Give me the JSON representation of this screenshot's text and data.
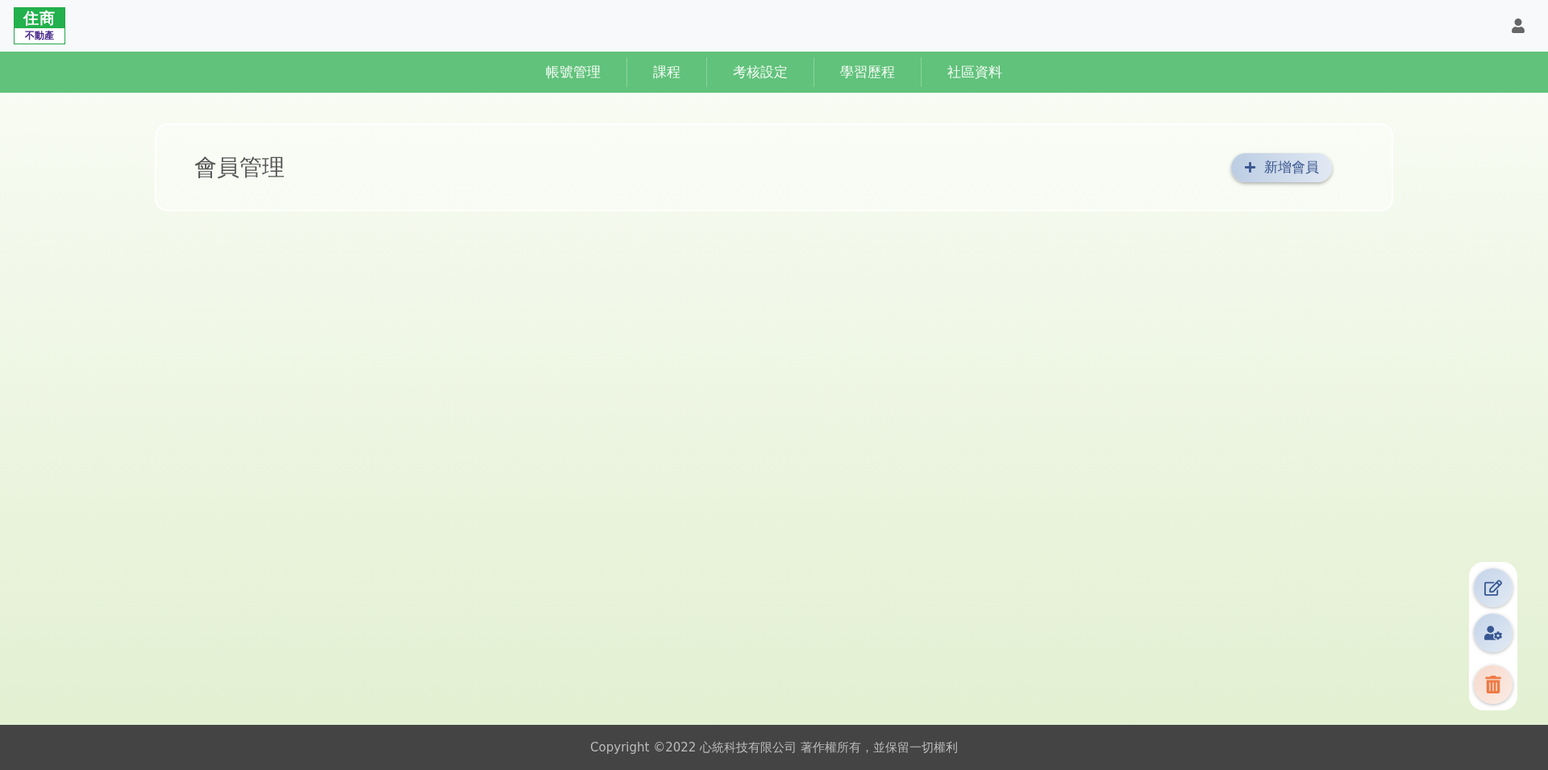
{
  "logo": {
    "top": "住商",
    "bottom": "不動產"
  },
  "nav": [
    {
      "label": "帳號管理"
    },
    {
      "label": "課程"
    },
    {
      "label": "考核設定"
    },
    {
      "label": "學習歷程"
    },
    {
      "label": "社區資料"
    }
  ],
  "panel": {
    "title": "會員管理",
    "add_button": "新增會員"
  },
  "float_actions": [
    {
      "kind": "edit"
    },
    {
      "kind": "user-settings"
    },
    {
      "kind": "delete"
    }
  ],
  "footer": "Copyright ©2022 心統科技有限公司 著作權所有，並保留一切權利"
}
